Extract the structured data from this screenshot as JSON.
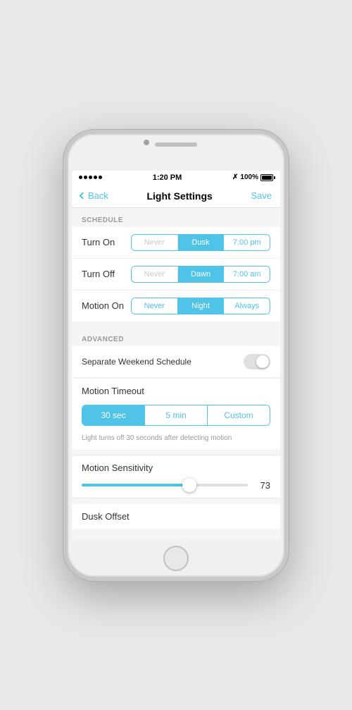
{
  "phone": {
    "status_bar": {
      "time": "1:20 PM",
      "battery": "100%",
      "signal_dots": 5
    }
  },
  "nav": {
    "back_label": "Back",
    "title": "Light Settings",
    "save_label": "Save"
  },
  "schedule": {
    "section_label": "SCHEDULE",
    "turn_on": {
      "label": "Turn On",
      "options": [
        "Never",
        "Dusk",
        "7:00 pm"
      ],
      "active": 1
    },
    "turn_off": {
      "label": "Turn Off",
      "options": [
        "Never",
        "Dawn",
        "7:00 am"
      ],
      "active": 1
    },
    "motion_on": {
      "label": "Motion On",
      "options": [
        "Never",
        "Night",
        "Always"
      ],
      "active": 1
    }
  },
  "advanced": {
    "section_label": "ADVANCED",
    "weekend_schedule": {
      "label": "Separate Weekend Schedule",
      "enabled": false
    },
    "motion_timeout": {
      "label": "Motion Timeout",
      "options": [
        "30 sec",
        "5 min",
        "Custom"
      ],
      "active": 0,
      "description": "Light turns off 30 seconds after detecting motion"
    },
    "motion_sensitivity": {
      "label": "Motion Sensitivity",
      "value": 73,
      "slider_percent": 65
    },
    "dusk_offset": {
      "label": "Dusk Offset"
    }
  }
}
